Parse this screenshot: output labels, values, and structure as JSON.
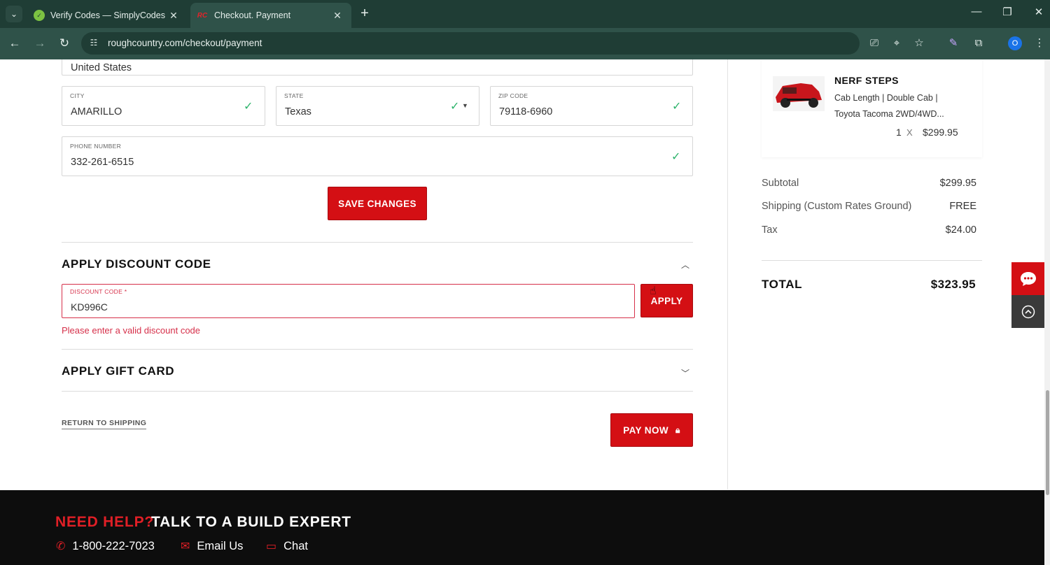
{
  "browser": {
    "tabs": [
      {
        "title": "Verify Codes — SimplyCodes",
        "favicon": "simplycodes-icon",
        "active": false
      },
      {
        "title": "Checkout. Payment",
        "favicon": "roughcountry-icon",
        "active": true
      }
    ],
    "url": "roughcountry.com/checkout/payment",
    "profile_initial": "O"
  },
  "address": {
    "country_value": "United States",
    "city_label": "CITY",
    "city_value": "AMARILLO",
    "state_label": "STATE",
    "state_value": "Texas",
    "zip_label": "ZIP CODE",
    "zip_value": "79118-6960",
    "phone_label": "PHONE NUMBER",
    "phone_value": "332-261-6515",
    "save_label": "SAVE CHANGES"
  },
  "discount": {
    "title": "APPLY DISCOUNT CODE",
    "field_label": "DISCOUNT CODE *",
    "field_value": "KD996C",
    "apply_label": "APPLY",
    "error": "Please enter a valid discount code"
  },
  "gift_card": {
    "title": "APPLY GIFT CARD"
  },
  "actions": {
    "return_label": "RETURN TO SHIPPING",
    "pay_label": "PAY NOW"
  },
  "order": {
    "item": {
      "name": "NERF STEPS",
      "desc_line1": "Cab Length | Double Cab |",
      "desc_line2": "Toyota Tacoma 2WD/4WD...",
      "qty": "1",
      "x": "X",
      "price": "$299.95"
    },
    "subtotal_label": "Subtotal",
    "subtotal_value": "$299.95",
    "shipping_label": "Shipping (Custom Rates Ground)",
    "shipping_value": "FREE",
    "tax_label": "Tax",
    "tax_value": "$24.00",
    "total_label": "TOTAL",
    "total_value": "$323.95"
  },
  "footer": {
    "need_help": "NEED HELP?",
    "talk": "TALK TO A BUILD EXPERT",
    "phone": "1-800-222-7023",
    "email": "Email Us",
    "chat": "Chat"
  },
  "colors": {
    "brand_red": "#d40f14",
    "success_green": "#2db36b",
    "error_red": "#d6304a",
    "chrome_green": "#2f5249"
  }
}
